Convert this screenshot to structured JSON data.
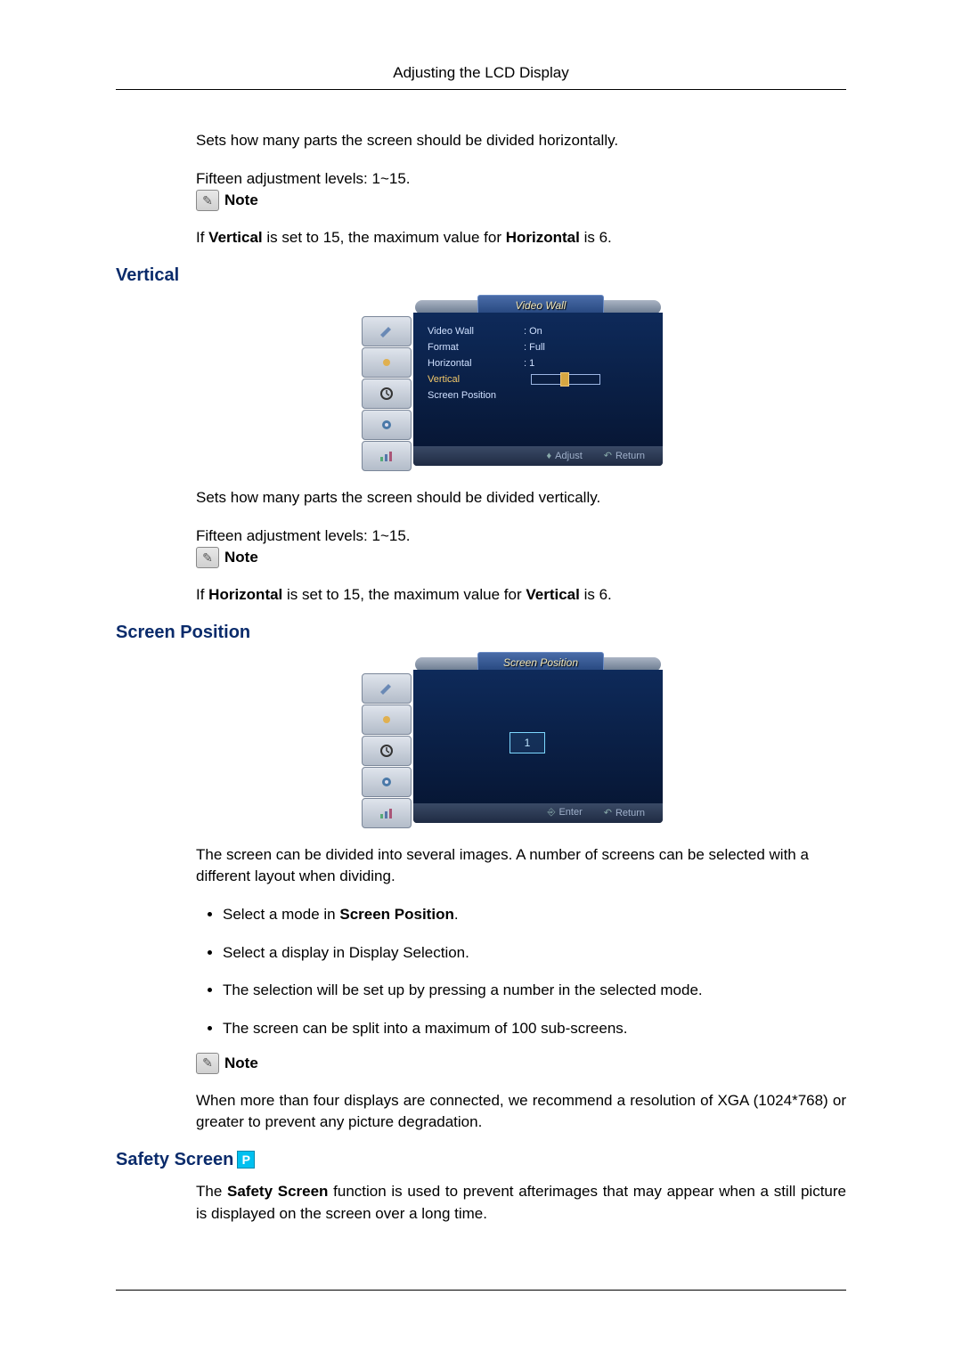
{
  "page_header": "Adjusting the LCD Display",
  "intro_horizontal": {
    "p1": "Sets how many parts the screen should be divided horizontally.",
    "p2": "Fifteen adjustment levels: 1~15.",
    "note_label": "Note",
    "note_text_parts": [
      "If ",
      "Vertical",
      " is set to 15, the maximum value for ",
      "Horizontal",
      " is 6."
    ]
  },
  "vertical": {
    "heading": "Vertical",
    "osd": {
      "title": "Video Wall",
      "items": [
        {
          "label": "Video Wall",
          "value": ": On",
          "selected": false
        },
        {
          "label": "Format",
          "value": ": Full",
          "selected": false
        },
        {
          "label": "Horizontal",
          "value": ": 1",
          "selected": false
        },
        {
          "label": "Vertical",
          "value": "",
          "selected": true,
          "slider": true
        },
        {
          "label": "Screen Position",
          "value": "",
          "selected": false
        }
      ],
      "hints": {
        "left": "Adjust",
        "left_icon": "♦",
        "right": "Return",
        "right_icon": "↶"
      }
    },
    "p1": "Sets how many parts the screen should be divided vertically.",
    "p2": "Fifteen adjustment levels: 1~15.",
    "note_label": "Note",
    "note_text_parts": [
      "If ",
      "Horizontal",
      " is set to 15, the maximum value for ",
      "Vertical",
      " is 6."
    ]
  },
  "screen_position": {
    "heading": "Screen Position",
    "osd": {
      "title": "Screen Position",
      "cell_value": "1",
      "hints": {
        "left": "Enter",
        "left_icon": "⎆",
        "right": "Return",
        "right_icon": "↶"
      }
    },
    "p1": "The screen can be divided into several images. A number of screens can be selected with a different layout when dividing.",
    "bullets": [
      {
        "prefix": "Select a mode in ",
        "bold": "Screen Position",
        "suffix": "."
      },
      {
        "text": "Select a display in Display Selection."
      },
      {
        "text": "The selection will be set up by pressing a number in the selected mode."
      },
      {
        "text": "The screen can be split into a maximum of 100 sub-screens."
      }
    ],
    "note_label": "Note",
    "note_text": "When more than four displays are connected, we recommend a resolution of XGA (1024*768) or greater to prevent any picture degradation."
  },
  "safety_screen": {
    "heading": "Safety Screen",
    "badge": "P",
    "p1_parts": [
      "The ",
      "Safety Screen",
      " function is used to prevent afterimages that may appear when a still picture is displayed on the screen over a long time."
    ]
  },
  "sidebar_icons": [
    "brush-icon",
    "sun-icon",
    "clock-icon",
    "gear-icon",
    "chart-icon"
  ]
}
